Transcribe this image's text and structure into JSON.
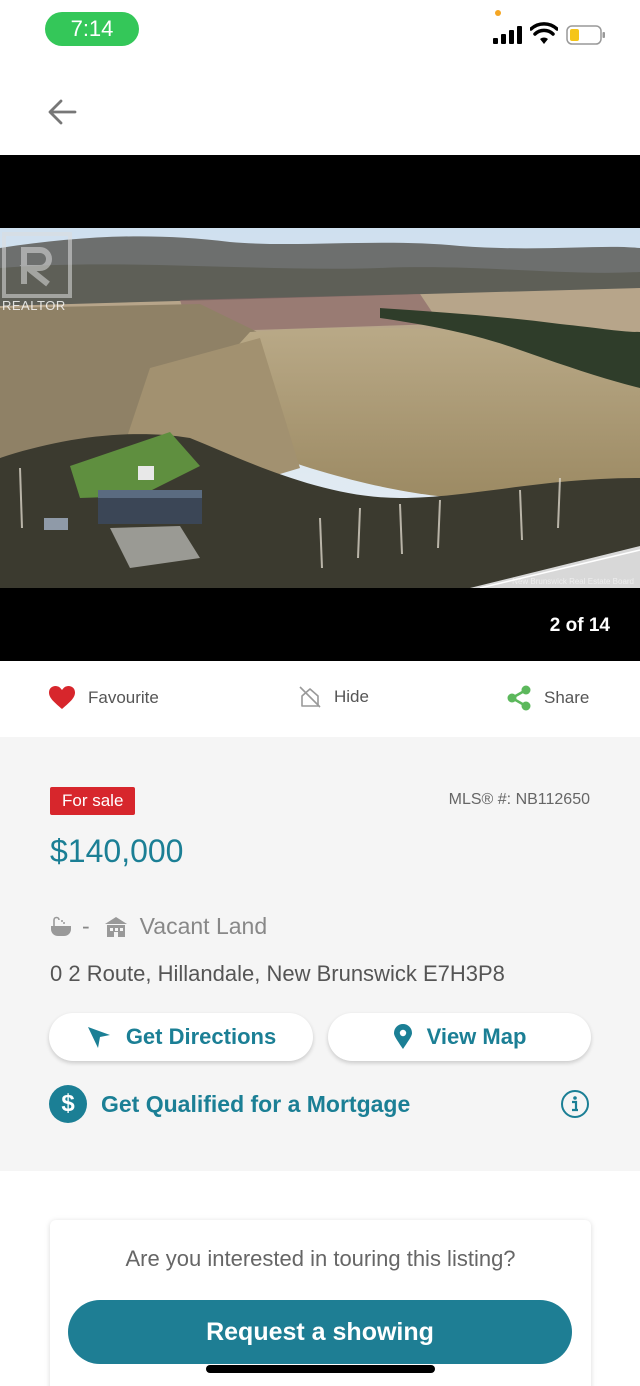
{
  "status_bar": {
    "time": "7:14"
  },
  "photo": {
    "watermark": "REALTOR",
    "credit": "New Brunswick Real Estate Board",
    "counter": "2 of 14"
  },
  "actions": {
    "favourite": "Favourite",
    "hide": "Hide",
    "share": "Share"
  },
  "listing": {
    "status_badge": "For sale",
    "mls": "MLS® #: NB112650",
    "price": "$140,000",
    "bath_value": "-",
    "property_type": "Vacant Land",
    "address": "0 2 Route, Hillandale, New Brunswick E7H3P8"
  },
  "buttons": {
    "directions": "Get Directions",
    "view_map": "View Map",
    "mortgage": "Get Qualified for a Mortgage",
    "mortgage_symbol": "$"
  },
  "tour": {
    "question": "Are you interested in touring this listing?",
    "request": "Request a showing"
  },
  "colors": {
    "accent": "#1b7f95",
    "sale_red": "#d7262c",
    "heart_red": "#d7262c",
    "share_green": "#5cb85c",
    "time_green": "#34c759"
  },
  "icons": {
    "back": "arrow-left-icon",
    "favourite": "heart-icon",
    "hide": "hide-icon",
    "share": "share-icon",
    "bath": "bathtub-icon",
    "property": "building-icon",
    "directions": "navigation-arrow-icon",
    "map": "map-pin-icon",
    "info": "info-icon"
  }
}
